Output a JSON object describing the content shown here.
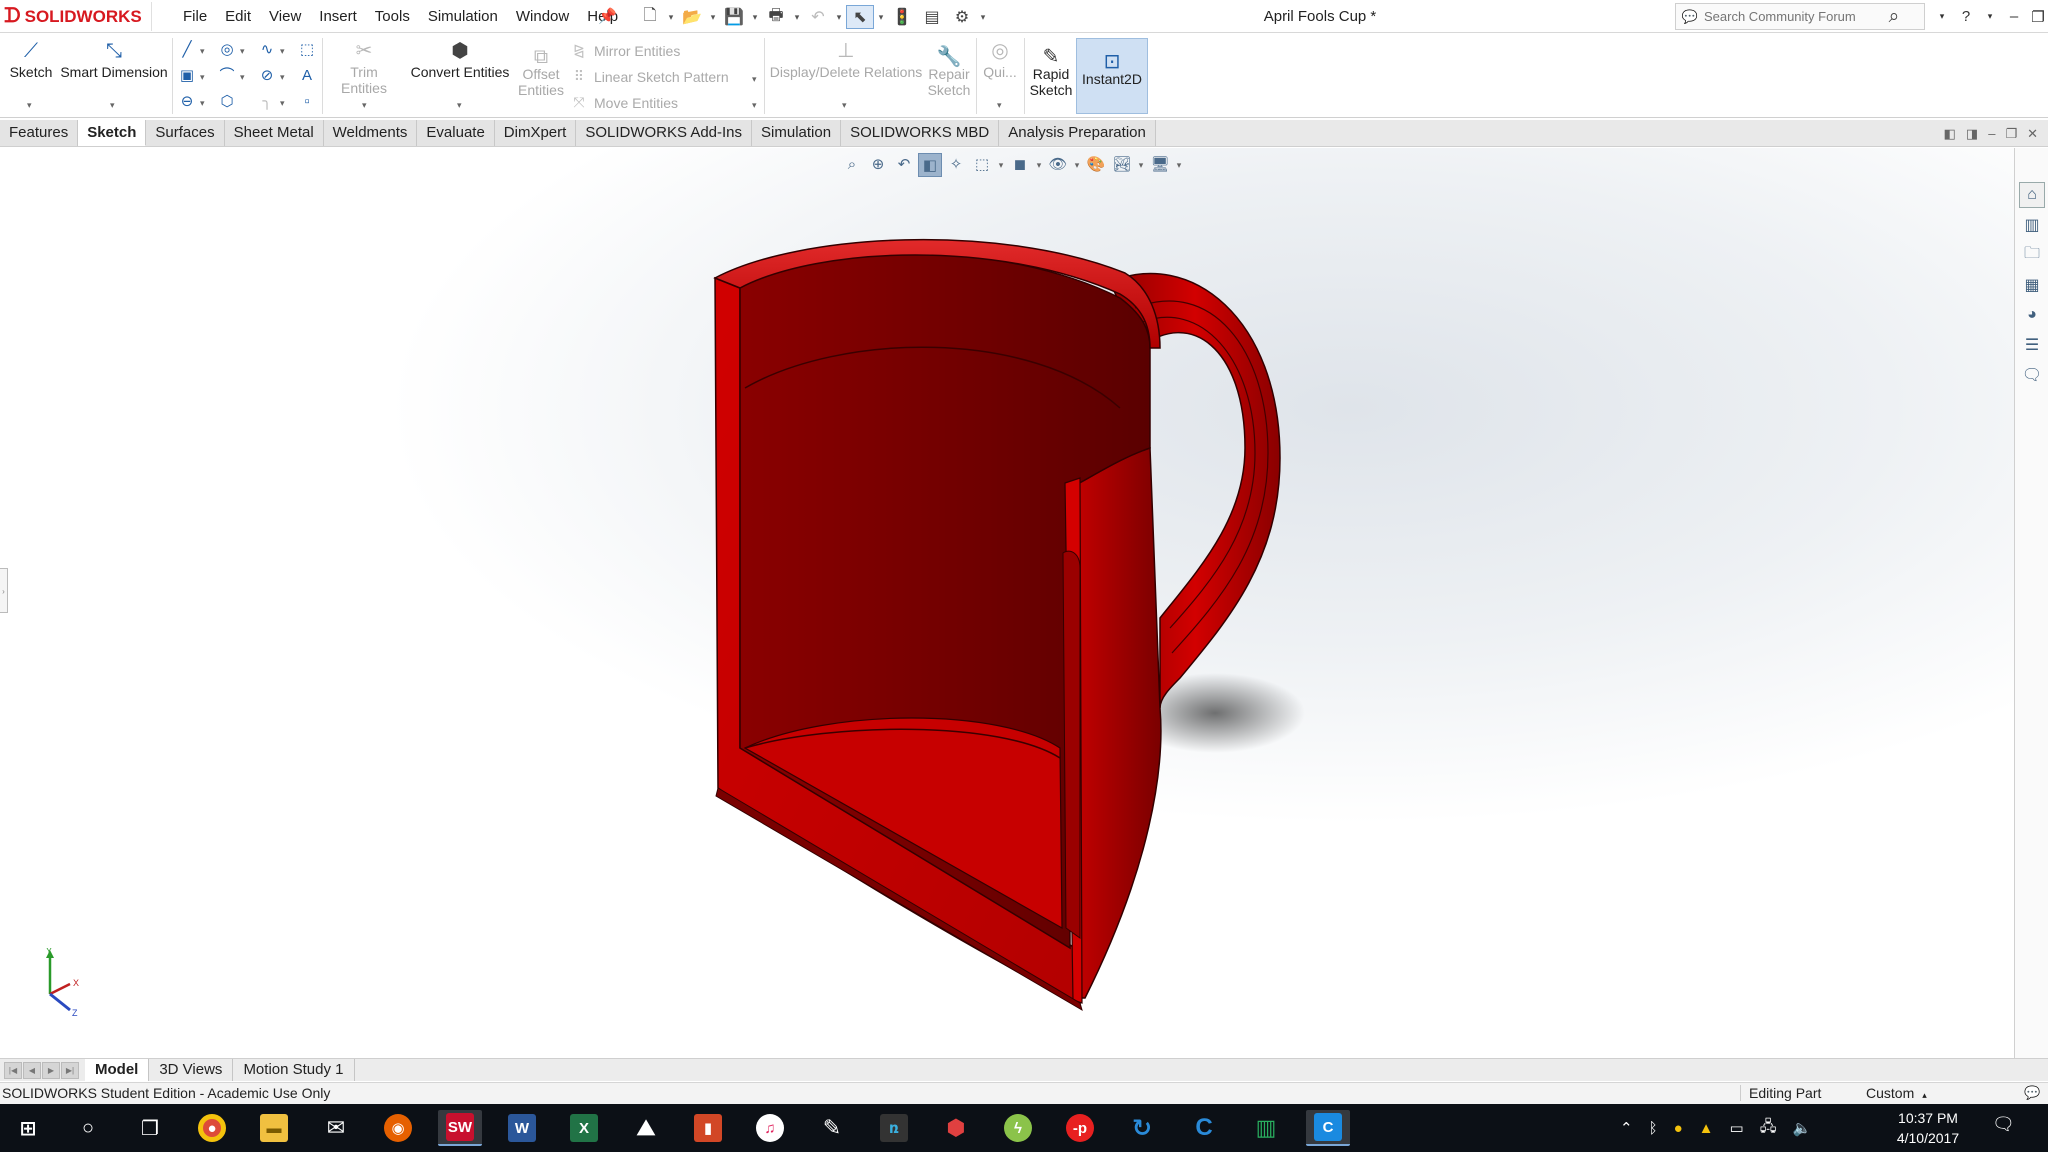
{
  "app": {
    "brand": "SOLIDWORKS",
    "document_title": "April Fools Cup *"
  },
  "menu": [
    "File",
    "Edit",
    "View",
    "Insert",
    "Tools",
    "Simulation",
    "Window",
    "Help"
  ],
  "search": {
    "placeholder": "Search Community Forum"
  },
  "help_label": "?",
  "command_manager": {
    "sketch": "Sketch",
    "smart_dimension": "Smart Dimension",
    "trim_entities": "Trim Entities",
    "convert_entities": "Convert Entities",
    "offset_entities_1": "Offset",
    "offset_entities_2": "Entities",
    "mirror_entities": "Mirror Entities",
    "linear_sketch_pattern": "Linear Sketch Pattern",
    "move_entities": "Move Entities",
    "display_delete_relations": "Display/Delete Relations",
    "repair_sketch_1": "Repair",
    "repair_sketch_2": "Sketch",
    "quick_snaps": "Qui...",
    "rapid_sketch_1": "Rapid",
    "rapid_sketch_2": "Sketch",
    "instant2d": "Instant2D"
  },
  "tabs": [
    {
      "label": "Features",
      "active": false
    },
    {
      "label": "Sketch",
      "active": true
    },
    {
      "label": "Surfaces",
      "active": false
    },
    {
      "label": "Sheet Metal",
      "active": false
    },
    {
      "label": "Weldments",
      "active": false
    },
    {
      "label": "Evaluate",
      "active": false
    },
    {
      "label": "DimXpert",
      "active": false
    },
    {
      "label": "SOLIDWORKS Add-Ins",
      "active": false
    },
    {
      "label": "Simulation",
      "active": false
    },
    {
      "label": "SOLIDWORKS MBD",
      "active": false
    },
    {
      "label": "Analysis Preparation",
      "active": false
    }
  ],
  "bottom_tabs": [
    {
      "label": "Model",
      "active": true
    },
    {
      "label": "3D Views",
      "active": false
    },
    {
      "label": "Motion Study 1",
      "active": false
    }
  ],
  "status": {
    "left": "SOLIDWORKS Student Edition - Academic Use Only",
    "state": "Editing Part",
    "units": "Custom"
  },
  "triad": {
    "x": "X",
    "y": "Y",
    "z": "Z"
  },
  "taskbar": {
    "time": "10:37 PM",
    "date": "4/10/2017"
  },
  "colors": {
    "model_red": "#c00000",
    "brand_red": "#d71920",
    "accent_blue": "#1f5fa8"
  }
}
